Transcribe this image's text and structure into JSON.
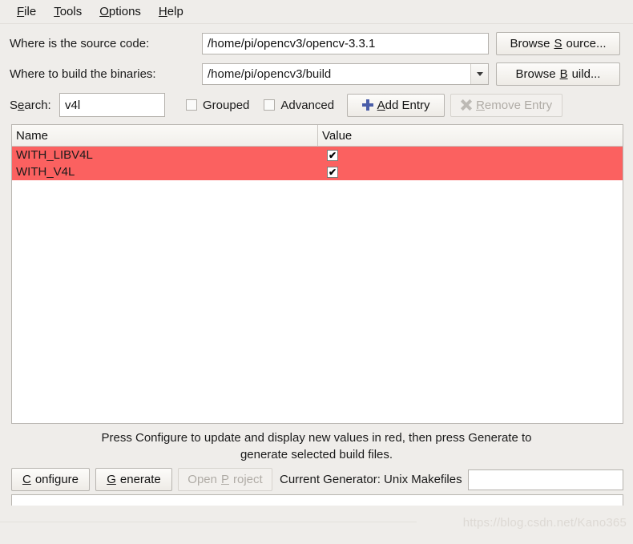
{
  "menu": {
    "items": [
      {
        "label": "File",
        "mnemonic": "F"
      },
      {
        "label": "Tools",
        "mnemonic": "T"
      },
      {
        "label": "Options",
        "mnemonic": "O"
      },
      {
        "label": "Help",
        "mnemonic": "H"
      }
    ]
  },
  "source_row": {
    "label": "Where is the source code:",
    "value": "/home/pi/opencv3/opencv-3.3.1",
    "browse_label_pre": "Browse ",
    "browse_mnemonic": "S",
    "browse_label_post": "ource..."
  },
  "build_row": {
    "label": "Where to build the binaries:",
    "value": "/home/pi/opencv3/build",
    "dropdown_icon": "chevron-down-icon",
    "browse_label_pre": "Browse ",
    "browse_mnemonic": "B",
    "browse_label_post": "uild..."
  },
  "search_row": {
    "label_pre": "S",
    "label_mnemonic": "e",
    "label_post": "arch:",
    "value": "v4l",
    "grouped_label": "Grouped",
    "grouped_checked": false,
    "advanced_label": "Advanced",
    "advanced_checked": false,
    "add_entry_pre": "",
    "add_entry_mnemonic": "A",
    "add_entry_post": "dd Entry",
    "add_entry_icon": "plus-icon",
    "remove_entry_pre": "",
    "remove_entry_mnemonic": "R",
    "remove_entry_post": "emove Entry",
    "remove_entry_icon": "close-x-icon",
    "remove_entry_disabled": true
  },
  "table": {
    "columns": [
      "Name",
      "Value"
    ],
    "rows": [
      {
        "name": "WITH_LIBV4L",
        "value": "✔",
        "checked": true,
        "highlight": "#fb6160"
      },
      {
        "name": "WITH_V4L",
        "value": "✔",
        "checked": true,
        "highlight": "#fb6160"
      }
    ]
  },
  "hint": {
    "line1": "Press Configure to update and display new values in red, then press Generate to",
    "line2": "generate selected build files."
  },
  "bottom": {
    "configure_mnemonic": "C",
    "configure_post": "onfigure",
    "generate_mnemonic": "G",
    "generate_post": "enerate",
    "open_project_pre": "Open ",
    "open_project_mnemonic": "P",
    "open_project_post": "roject",
    "open_project_disabled": true,
    "generator_label": "Current Generator: Unix Makefiles",
    "progress_value": ""
  },
  "watermark": {
    "text": "https://blog.csdn.net/Kano365"
  },
  "colors": {
    "highlight_red": "#fb6160",
    "window_bg": "#efedea",
    "accent_blue": "#4a5da8"
  }
}
